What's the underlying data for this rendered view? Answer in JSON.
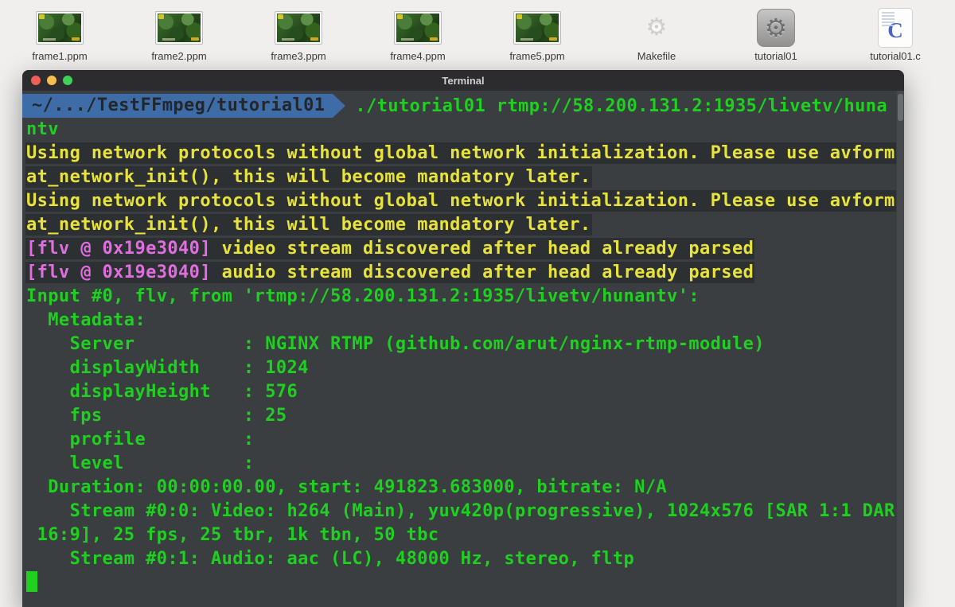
{
  "desktop": {
    "icons": [
      {
        "label": "frame1.ppm",
        "type": "image"
      },
      {
        "label": "frame2.ppm",
        "type": "image"
      },
      {
        "label": "frame3.ppm",
        "type": "image"
      },
      {
        "label": "frame4.ppm",
        "type": "image"
      },
      {
        "label": "frame5.ppm",
        "type": "image"
      },
      {
        "label": "Makefile",
        "type": "gear-light"
      },
      {
        "label": "tutorial01",
        "type": "gear-dark"
      },
      {
        "label": "tutorial01.c",
        "type": "c-source",
        "glyph": "C"
      }
    ],
    "icon_glyphs": {
      "gear": "⚙"
    }
  },
  "terminal": {
    "title": "Terminal",
    "window_buttons": [
      "close",
      "minimize",
      "zoom"
    ],
    "colors": {
      "background": "#3b3e41",
      "line_band": "#2d3032",
      "green": "#1fd020",
      "yellow": "#e7e33c",
      "magenta": "#e06ede",
      "prompt_blue": "#3e6ca6"
    },
    "lines": [
      {
        "type": "prompt",
        "path": "~/.../TestFFmpeg/tutorial01",
        "command": "./tutorial01 rtmp://58.200.131.2:1935/livetv/huna"
      },
      {
        "type": "text",
        "spans": [
          {
            "t": "ntv",
            "c": "green"
          }
        ]
      },
      {
        "type": "text",
        "spans": [
          {
            "t": "Using network protocols without global network initialization. Please use avform",
            "c": "yellow",
            "band": true
          }
        ]
      },
      {
        "type": "text",
        "spans": [
          {
            "t": "at_network_init(), this will become mandatory later.",
            "c": "yellow",
            "band": true
          }
        ]
      },
      {
        "type": "text",
        "spans": [
          {
            "t": "Using network protocols without global network initialization. Please use avform",
            "c": "yellow",
            "band": true
          }
        ]
      },
      {
        "type": "text",
        "spans": [
          {
            "t": "at_network_init(), this will become mandatory later.",
            "c": "yellow",
            "band": true
          }
        ]
      },
      {
        "type": "text",
        "spans": [
          {
            "t": "[flv @ 0x19e3040] ",
            "c": "magenta",
            "band": true
          },
          {
            "t": "video stream discovered after head already parsed",
            "c": "yellow",
            "band": true
          }
        ]
      },
      {
        "type": "text",
        "spans": [
          {
            "t": "[flv @ 0x19e3040] ",
            "c": "magenta",
            "band": true
          },
          {
            "t": "audio stream discovered after head already parsed",
            "c": "yellow",
            "band": true
          }
        ]
      },
      {
        "type": "text",
        "spans": [
          {
            "t": "Input #0, flv, from 'rtmp://58.200.131.2:1935/livetv/hunantv':",
            "c": "green"
          }
        ]
      },
      {
        "type": "text",
        "spans": [
          {
            "t": "  Metadata:",
            "c": "green"
          }
        ]
      },
      {
        "type": "text",
        "spans": [
          {
            "t": "    Server          : NGINX RTMP (github.com/arut/nginx-rtmp-module)",
            "c": "green"
          }
        ]
      },
      {
        "type": "text",
        "spans": [
          {
            "t": "    displayWidth    : 1024",
            "c": "green"
          }
        ]
      },
      {
        "type": "text",
        "spans": [
          {
            "t": "    displayHeight   : 576",
            "c": "green"
          }
        ]
      },
      {
        "type": "text",
        "spans": [
          {
            "t": "    fps             : 25",
            "c": "green"
          }
        ]
      },
      {
        "type": "text",
        "spans": [
          {
            "t": "    profile         :",
            "c": "green"
          }
        ]
      },
      {
        "type": "text",
        "spans": [
          {
            "t": "    level           :",
            "c": "green"
          }
        ]
      },
      {
        "type": "text",
        "spans": [
          {
            "t": "  Duration: 00:00:00.00, start: 491823.683000, bitrate: N/A",
            "c": "green"
          }
        ]
      },
      {
        "type": "text",
        "spans": [
          {
            "t": "    Stream #0:0: Video: h264 (Main), yuv420p(progressive), 1024x576 [SAR 1:1 DAR",
            "c": "green"
          }
        ]
      },
      {
        "type": "text",
        "spans": [
          {
            "t": " 16:9], 25 fps, 25 tbr, 1k tbn, 50 tbc",
            "c": "green"
          }
        ]
      },
      {
        "type": "text",
        "spans": [
          {
            "t": "    Stream #0:1: Audio: aac (LC), 48000 Hz, stereo, fltp",
            "c": "green"
          }
        ]
      },
      {
        "type": "cursor"
      }
    ]
  }
}
